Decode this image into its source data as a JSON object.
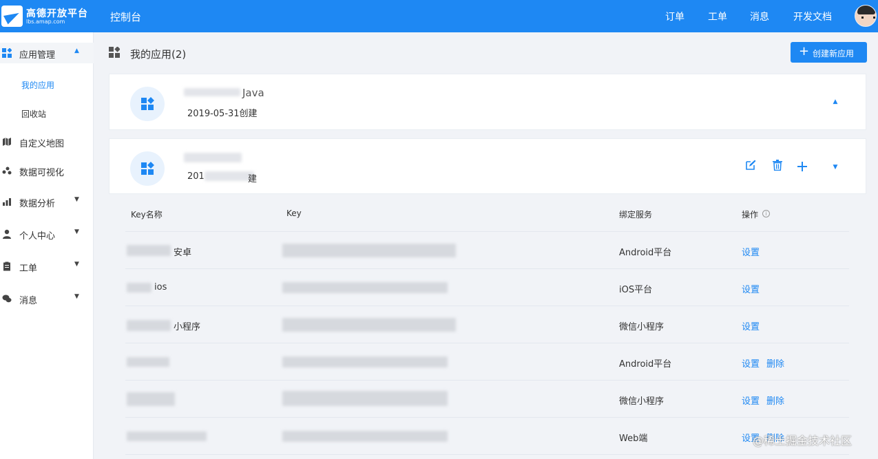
{
  "topbar": {
    "logo_title": "高德开放平台",
    "logo_sub": "lbs.amap.com",
    "console": "控制台",
    "nav": [
      "订单",
      "工单",
      "消息",
      "开发文档"
    ]
  },
  "sidebar": {
    "items": [
      {
        "label": "应用管理",
        "icon": "apps-icon"
      },
      {
        "label": "我的应用"
      },
      {
        "label": "回收站"
      },
      {
        "label": "自定义地图",
        "icon": "map-icon"
      },
      {
        "label": "数据可视化",
        "icon": "dots-icon"
      },
      {
        "label": "数据分析",
        "icon": "bar-chart-icon"
      },
      {
        "label": "个人中心",
        "icon": "user-icon"
      },
      {
        "label": "工单",
        "icon": "clipboard-icon"
      },
      {
        "label": "消息",
        "icon": "chat-icon"
      }
    ]
  },
  "page": {
    "title": "我的应用(2)",
    "create_button": "创建新应用"
  },
  "apps": [
    {
      "name_suffix": "Java",
      "date": "2019-05-31创建"
    },
    {
      "date_prefix": "201",
      "date_suffix": "建"
    }
  ],
  "table": {
    "headers": [
      "Key名称",
      "Key",
      "绑定服务",
      "操作"
    ],
    "rows": [
      {
        "name": "安卓",
        "service": "Android平台",
        "actions": [
          "设置"
        ]
      },
      {
        "name": "ios",
        "service": "iOS平台",
        "actions": [
          "设置"
        ]
      },
      {
        "name": "小程序",
        "service": "微信小程序",
        "actions": [
          "设置"
        ]
      },
      {
        "name": "",
        "service": "Android平台",
        "actions": [
          "设置",
          "删除"
        ]
      },
      {
        "name": "",
        "service": "微信小程序",
        "actions": [
          "设置",
          "删除"
        ]
      },
      {
        "name": "",
        "service": "Web端",
        "actions": [
          "设置",
          "删除"
        ]
      }
    ]
  },
  "watermark": "@稀土掘金技术社区",
  "colors": {
    "accent": "#1e88f3",
    "topbar": "#1e88f3",
    "background": "#f1f3f7"
  }
}
